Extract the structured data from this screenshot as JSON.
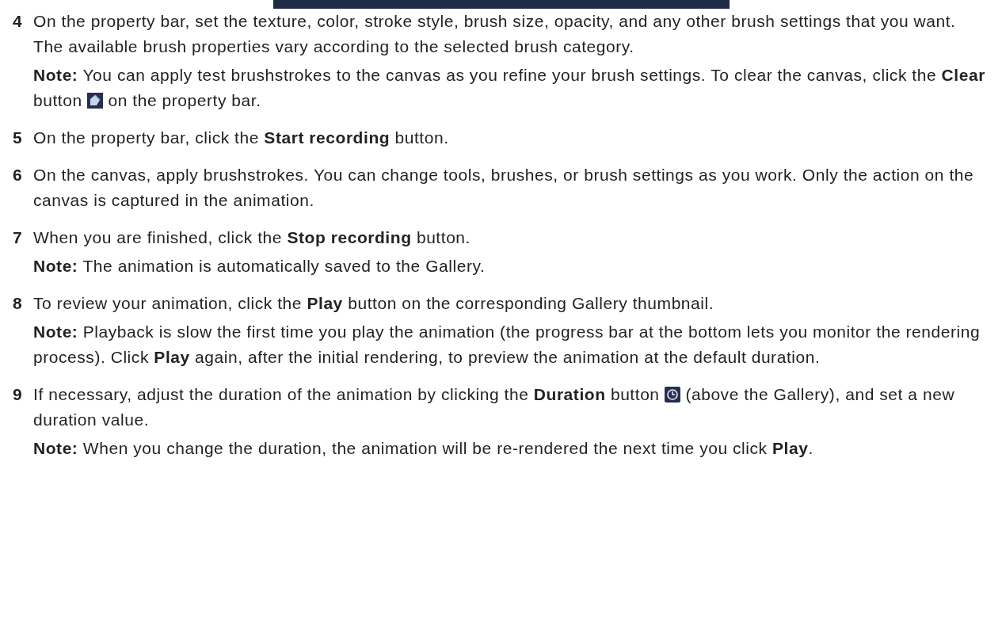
{
  "steps": [
    {
      "number": "4",
      "paragraphs": [
        {
          "parts": [
            {
              "kind": "text",
              "text": "On the property bar, set the texture, color, stroke style, brush size, opacity, and any other brush settings that you want. The available brush properties vary according to the selected brush category."
            }
          ]
        },
        {
          "parts": [
            {
              "kind": "text",
              "text": "**Note:**  You can apply test brushstrokes to the canvas as you refine your brush settings. To clear the canvas, click the **Clear** button "
            },
            {
              "kind": "eraser_icon"
            },
            {
              "kind": "text",
              "text": " on the property bar."
            }
          ]
        }
      ]
    },
    {
      "number": "5",
      "paragraphs": [
        {
          "parts": [
            {
              "kind": "text",
              "text": "On the property bar, click the **Start recording** button."
            }
          ]
        }
      ]
    },
    {
      "number": "6",
      "paragraphs": [
        {
          "parts": [
            {
              "kind": "text",
              "text": "On the canvas, apply brushstrokes. You can change tools, brushes, or brush settings as you work. Only the action on the canvas is captured in the animation."
            }
          ]
        }
      ]
    },
    {
      "number": "7",
      "paragraphs": [
        {
          "parts": [
            {
              "kind": "text",
              "text": "When you are finished, click the **Stop recording** button."
            }
          ]
        },
        {
          "parts": [
            {
              "kind": "text",
              "text": "**Note:**  The animation is automatically saved to the Gallery."
            }
          ]
        }
      ]
    },
    {
      "number": "8",
      "paragraphs": [
        {
          "parts": [
            {
              "kind": "text",
              "text": "To review your animation, click the **Play** button on the corresponding Gallery thumbnail."
            }
          ]
        },
        {
          "parts": [
            {
              "kind": "text",
              "text": "**Note:**  Playback is slow the first time you play the animation (the progress bar at the bottom lets you monitor the rendering process). Click **Play** again, after the initial rendering, to preview the animation at the default duration."
            }
          ]
        }
      ]
    },
    {
      "number": "9",
      "paragraphs": [
        {
          "parts": [
            {
              "kind": "text",
              "text": "If necessary, adjust the duration of the animation by clicking the **Duration** button "
            },
            {
              "kind": "clock_icon"
            },
            {
              "kind": "text",
              "text": " (above the Gallery), and set a new duration value."
            }
          ]
        },
        {
          "parts": [
            {
              "kind": "text",
              "text": "**Note:**  When you change the duration, the animation will be re-rendered the next time you click **Play**."
            }
          ]
        }
      ]
    }
  ]
}
